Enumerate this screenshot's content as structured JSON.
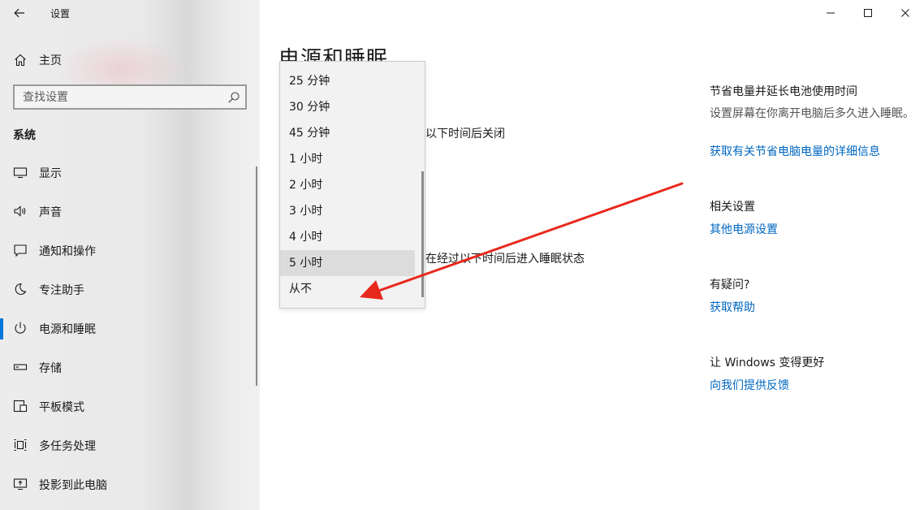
{
  "window": {
    "app_title": "设置",
    "back_icon": "back-arrow-icon",
    "controls": [
      "minimize-icon",
      "maximize-icon",
      "close-icon"
    ]
  },
  "sidebar": {
    "home": {
      "label": "主页",
      "icon": "home-icon"
    },
    "search": {
      "placeholder": "查找设置",
      "value": "",
      "icon": "search-icon"
    },
    "section_title": "系统",
    "items": [
      {
        "label": "显示",
        "icon": "display-icon",
        "active": false
      },
      {
        "label": "声音",
        "icon": "speaker-icon",
        "active": false
      },
      {
        "label": "通知和操作",
        "icon": "notification-icon",
        "active": false
      },
      {
        "label": "专注助手",
        "icon": "moon-icon",
        "active": false
      },
      {
        "label": "电源和睡眠",
        "icon": "power-icon",
        "active": true
      },
      {
        "label": "存储",
        "icon": "storage-icon",
        "active": false
      },
      {
        "label": "平板模式",
        "icon": "tablet-icon",
        "active": false
      },
      {
        "label": "多任务处理",
        "icon": "multitask-icon",
        "active": false
      },
      {
        "label": "投影到此电脑",
        "icon": "project-icon",
        "active": false
      }
    ],
    "accent_color": "#0078d7"
  },
  "main": {
    "page_title": "电源和睡眠",
    "screen_setting_label": "以下时间后关闭",
    "sleep_setting_label": "在经过以下时间后进入睡眠状态",
    "dropdown": {
      "options": [
        "25 分钟",
        "30 分钟",
        "45 分钟",
        "1 小时",
        "2 小时",
        "3 小时",
        "4 小时",
        "5 小时",
        "从不"
      ],
      "selected": "5 小时"
    }
  },
  "right_panel": {
    "tips": {
      "heading": "节省电量并延长电池使用时间",
      "description": "设置屏幕在你离开电脑后多久进入睡眠。",
      "link": "获取有关节省电脑电量的详细信息"
    },
    "related": {
      "heading": "相关设置",
      "link": "其他电源设置"
    },
    "question": {
      "heading": "有疑问?",
      "link": "获取帮助"
    },
    "feedback": {
      "heading": "让 Windows 变得更好",
      "link": "向我们提供反馈"
    },
    "link_color": "#0067c0"
  },
  "annotation": {
    "type": "arrow",
    "color": "#e8281c"
  }
}
